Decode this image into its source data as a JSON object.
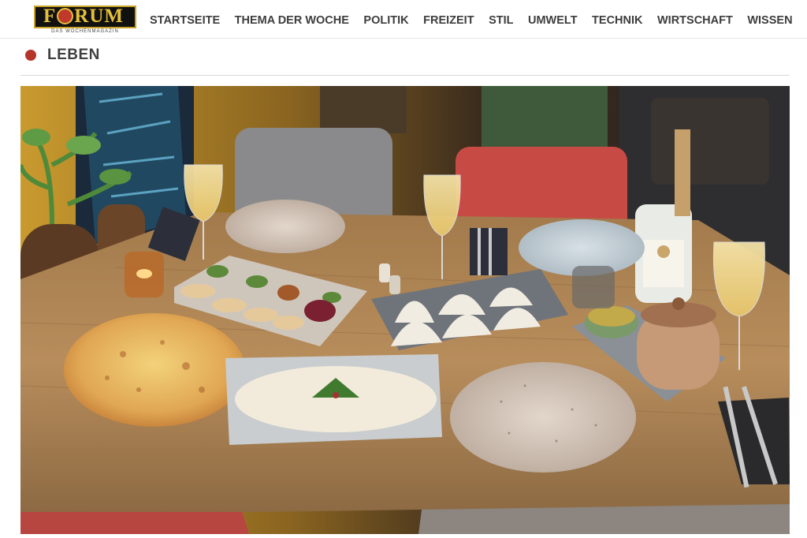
{
  "brand": {
    "name": "FORUM",
    "tagline": "DAS WOCHENMAGAZIN"
  },
  "nav": {
    "items": [
      {
        "label": "STARTSEITE",
        "key": "startseite"
      },
      {
        "label": "THEMA DER WOCHE",
        "key": "thema-der-woche"
      },
      {
        "label": "POLITIK",
        "key": "politik"
      },
      {
        "label": "FREIZEIT",
        "key": "freizeit"
      },
      {
        "label": "STIL",
        "key": "stil"
      },
      {
        "label": "UMWELT",
        "key": "umwelt"
      },
      {
        "label": "TECHNIK",
        "key": "technik"
      },
      {
        "label": "WIRTSCHAFT",
        "key": "wirtschaft"
      },
      {
        "label": "WISSEN",
        "key": "wissen"
      }
    ]
  },
  "section": {
    "title": "LEBEN",
    "accent_color": "#b5352b"
  },
  "colors": {
    "brand_gold": "#e3bf3a",
    "brand_red": "#c0392b",
    "nav_text": "#3d3d3d"
  }
}
